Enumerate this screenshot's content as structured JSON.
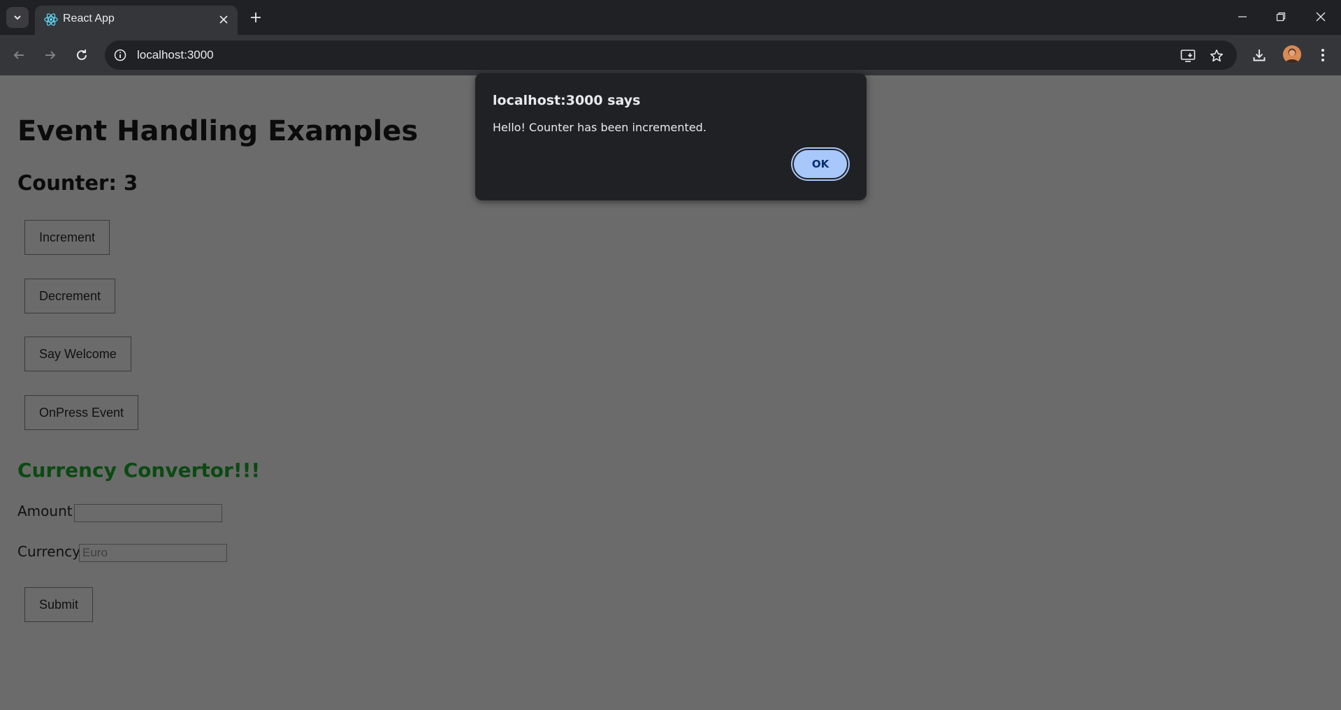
{
  "browser": {
    "tab_title": "React App",
    "url": "localhost:3000",
    "colors": {
      "frame": "#202124",
      "toolbar": "#35363a",
      "text": "#e8eaed"
    }
  },
  "page": {
    "heading": "Event Handling Examples",
    "counter_label": "Counter: 3",
    "buttons": {
      "increment": "Increment",
      "decrement": "Decrement",
      "say_welcome": "Say Welcome",
      "onpress": "OnPress Event",
      "submit": "Submit"
    },
    "currency_heading": "Currency Convertor!!!",
    "amount_label": "Amount:",
    "amount_value": "",
    "currency_label": "Currency:",
    "currency_placeholder": "Euro",
    "colors": {
      "background": "#6b6b6b",
      "currency_heading": "#0b4a12"
    }
  },
  "dialog": {
    "title": "localhost:3000 says",
    "message": "Hello! Counter has been incremented.",
    "ok_label": "OK",
    "colors": {
      "background": "#202124",
      "ok_button": "#a8c7fa"
    }
  }
}
